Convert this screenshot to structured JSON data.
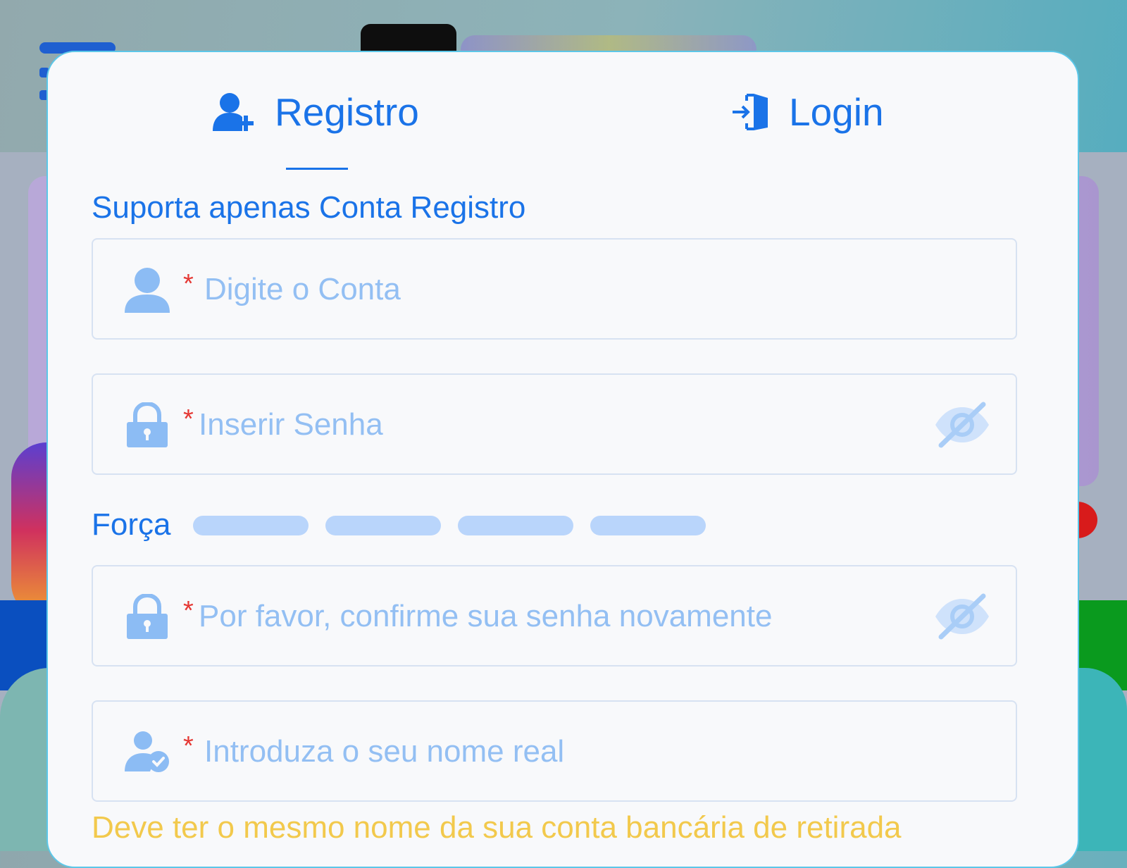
{
  "tabs": {
    "registro_label": "Registro",
    "login_label": "Login"
  },
  "support_text": "Suporta apenas Conta Registro",
  "fields": {
    "account": {
      "required_mark": "*",
      "placeholder": "Digite o Conta"
    },
    "password": {
      "required_mark": "*",
      "placeholder": "Inserir Senha"
    },
    "confirm_password": {
      "required_mark": "*",
      "placeholder": "Por favor, confirme sua senha novamente"
    },
    "real_name": {
      "required_mark": "*",
      "placeholder": "Introduza o seu nome real"
    }
  },
  "strength": {
    "label": "Força",
    "level": 0,
    "segments": 4
  },
  "notice": "Deve ter o mesmo nome da sua conta bancária de retirada",
  "colors": {
    "accent": "#1a73e8",
    "placeholder": "#93bff3",
    "required": "#e53935",
    "strength_bar": "#b9d5fb",
    "notice": "#f2c94c",
    "modal_border": "#5cc7e8"
  },
  "icons": [
    "user-plus-icon",
    "login-door-icon",
    "user-icon",
    "lock-icon",
    "eye-off-icon",
    "user-check-icon"
  ]
}
